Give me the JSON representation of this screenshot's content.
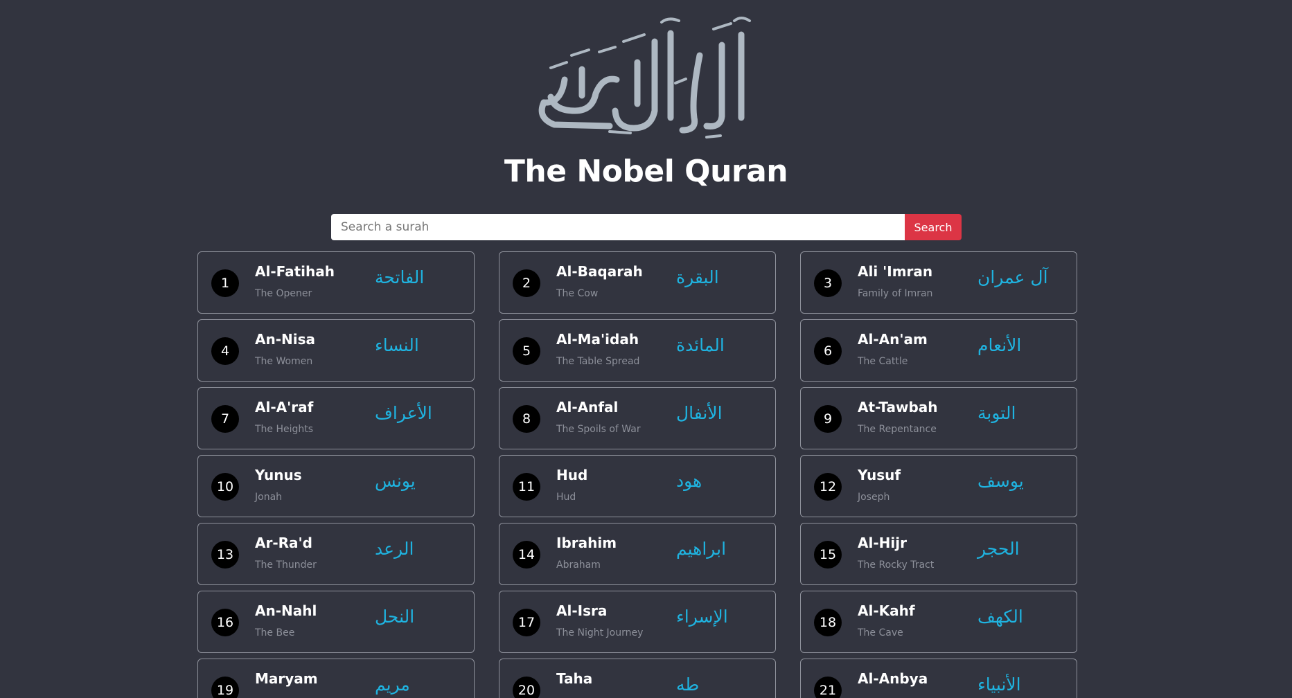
{
  "header": {
    "logo_text": "القرآن الكريم",
    "title": "The Nobel Quran"
  },
  "search": {
    "placeholder": "Search a surah",
    "value": "",
    "button_label": "Search"
  },
  "colors": {
    "background": "#32343f",
    "accent_arabic": "#1fb3e0",
    "search_button": "#dc3545",
    "number_badge": "#000000"
  },
  "surahs": [
    {
      "number": "1",
      "name": "Al-Fatihah",
      "meaning": "The Opener",
      "arabic": "الفاتحة"
    },
    {
      "number": "2",
      "name": "Al-Baqarah",
      "meaning": "The Cow",
      "arabic": "البقرة"
    },
    {
      "number": "3",
      "name": "Ali 'Imran",
      "meaning": "Family of Imran",
      "arabic": "آل عمران"
    },
    {
      "number": "4",
      "name": "An-Nisa",
      "meaning": "The Women",
      "arabic": "النساء"
    },
    {
      "number": "5",
      "name": "Al-Ma'idah",
      "meaning": "The Table Spread",
      "arabic": "المائدة"
    },
    {
      "number": "6",
      "name": "Al-An'am",
      "meaning": "The Cattle",
      "arabic": "الأنعام"
    },
    {
      "number": "7",
      "name": "Al-A'raf",
      "meaning": "The Heights",
      "arabic": "الأعراف"
    },
    {
      "number": "8",
      "name": "Al-Anfal",
      "meaning": "The Spoils of War",
      "arabic": "الأنفال"
    },
    {
      "number": "9",
      "name": "At-Tawbah",
      "meaning": "The Repentance",
      "arabic": "التوبة"
    },
    {
      "number": "10",
      "name": "Yunus",
      "meaning": "Jonah",
      "arabic": "يونس"
    },
    {
      "number": "11",
      "name": "Hud",
      "meaning": "Hud",
      "arabic": "هود"
    },
    {
      "number": "12",
      "name": "Yusuf",
      "meaning": "Joseph",
      "arabic": "يوسف"
    },
    {
      "number": "13",
      "name": "Ar-Ra'd",
      "meaning": "The Thunder",
      "arabic": "الرعد"
    },
    {
      "number": "14",
      "name": "Ibrahim",
      "meaning": "Abraham",
      "arabic": "ابراهيم"
    },
    {
      "number": "15",
      "name": "Al-Hijr",
      "meaning": "The Rocky Tract",
      "arabic": "الحجر"
    },
    {
      "number": "16",
      "name": "An-Nahl",
      "meaning": "The Bee",
      "arabic": "النحل"
    },
    {
      "number": "17",
      "name": "Al-Isra",
      "meaning": "The Night Journey",
      "arabic": "الإسراء"
    },
    {
      "number": "18",
      "name": "Al-Kahf",
      "meaning": "The Cave",
      "arabic": "الكهف"
    },
    {
      "number": "19",
      "name": "Maryam",
      "meaning": "",
      "arabic": "مريم"
    },
    {
      "number": "20",
      "name": "Taha",
      "meaning": "",
      "arabic": "طه"
    },
    {
      "number": "21",
      "name": "Al-Anbya",
      "meaning": "",
      "arabic": "الأنبياء"
    }
  ]
}
